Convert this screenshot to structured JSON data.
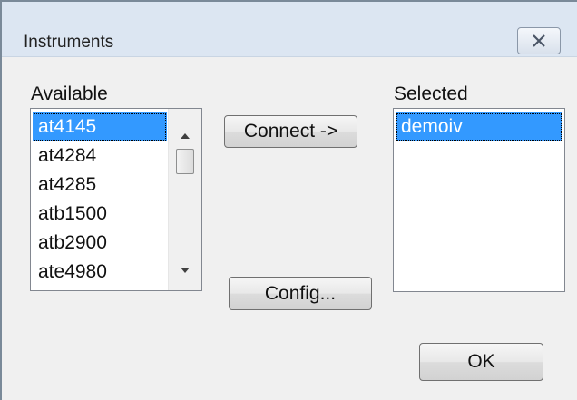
{
  "window": {
    "title": "Instruments",
    "close_icon": "close-icon"
  },
  "available": {
    "label": "Available",
    "items": [
      "at4145",
      "at4284",
      "at4285",
      "atb1500",
      "atb2900",
      "ate4980"
    ],
    "selected_index": 0
  },
  "selected": {
    "label": "Selected",
    "items": [
      "demoiv"
    ],
    "selected_index": 0
  },
  "buttons": {
    "connect": "Connect ->",
    "config": "Config...",
    "ok": "OK"
  },
  "colors": {
    "selection": "#3399ff",
    "titlebar": "#dce6f2",
    "dialog_bg": "#f0f0f0"
  }
}
